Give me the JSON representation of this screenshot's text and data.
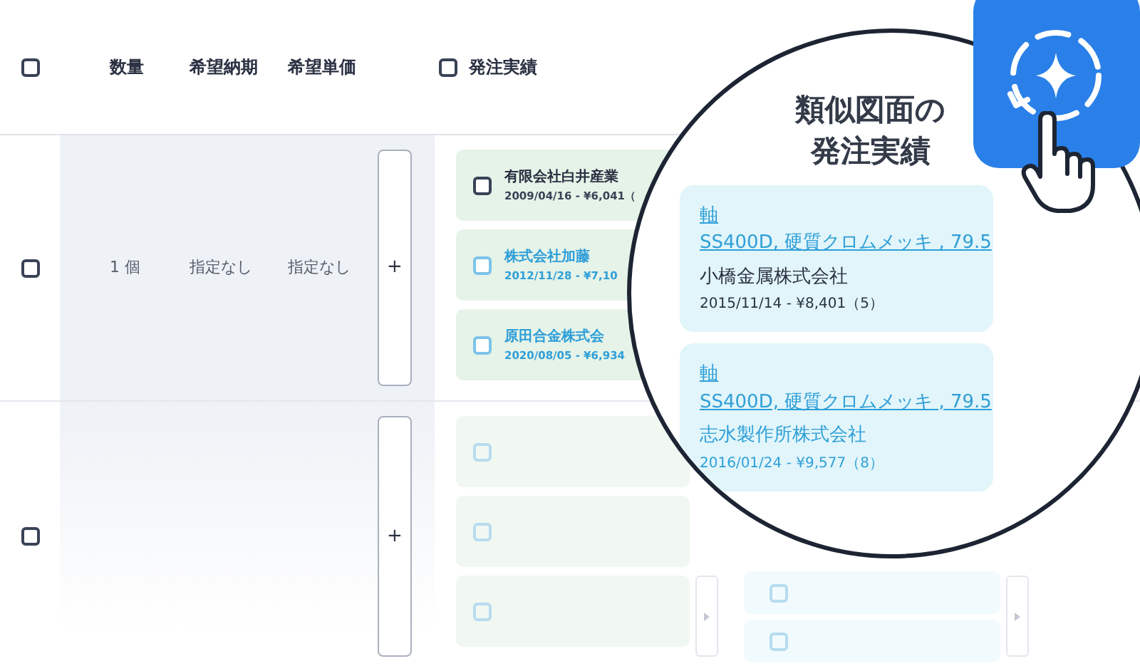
{
  "table": {
    "header": {
      "select_all": {
        "checked": false
      },
      "columns": [
        "数量",
        "希望納期",
        "希望単価"
      ],
      "orders_header": {
        "label": "発注実績",
        "checked": false
      }
    },
    "rows": [
      {
        "checked": false,
        "quantity": "1 個",
        "delivery": "指定なし",
        "unit_price": "指定なし",
        "add_label": "+",
        "orders": [
          {
            "kind": "plain",
            "checked": false,
            "company": "有限会社白井産業",
            "detail": "2009/04/16 - ¥6,041（"
          },
          {
            "kind": "linked",
            "checked": false,
            "company": "株式会社加藤",
            "detail": "2012/11/28 - ¥7,10"
          },
          {
            "kind": "linked",
            "checked": false,
            "company": "原田合金株式会",
            "detail": "2020/08/05 - ¥6,934"
          }
        ],
        "similar": []
      },
      {
        "checked": false,
        "add_label": "+",
        "orders": [
          {
            "kind": "empty",
            "checked": false
          },
          {
            "kind": "empty",
            "checked": false
          },
          {
            "kind": "empty",
            "checked": false
          }
        ],
        "similar": [
          {
            "kind": "empty",
            "checked": false
          },
          {
            "kind": "empty",
            "checked": false
          }
        ]
      }
    ]
  },
  "magnifier": {
    "title_lines": [
      "類似図面の",
      "発注実績"
    ],
    "cards": [
      {
        "kind": "plain",
        "part": "軸",
        "spec": "SS400D, 硬質クロムメッキ , 79.5",
        "company": "小橋金属株式会社",
        "detail": "2015/11/14 - ¥8,401（5）"
      },
      {
        "kind": "linked",
        "part": "軸",
        "spec": "SS400D, 硬質クロムメッキ , 79.5",
        "company": "志水製作所株式会社",
        "detail": "2016/01/24 - ¥9,577（8）"
      }
    ]
  }
}
